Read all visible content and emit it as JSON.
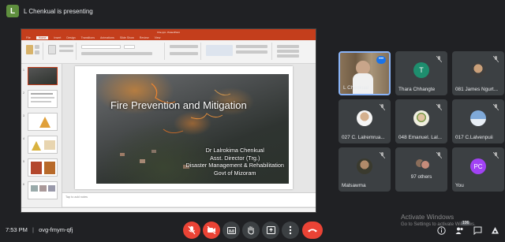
{
  "presenting": {
    "badge": "L",
    "text": "L Chenkual is presenting"
  },
  "ppt": {
    "title_text": "Fire ppt - PowerPoint",
    "tabs": [
      "File",
      "Home",
      "Insert",
      "Design",
      "Transitions",
      "Animations",
      "Slide Show",
      "Review",
      "View"
    ],
    "slide_title": "Fire Prevention and Mitigation",
    "slide_sub": [
      "Dr Lalrokima Chenkual",
      "Asst. Director (Trg.)",
      "Disaster Management & Rehabilitation",
      "Govt of Mizoram"
    ],
    "notes_placeholder": "Tap to add notes"
  },
  "participants": [
    {
      "name": "L Chenkual",
      "kind": "video-speaker"
    },
    {
      "name": "Thara Chhangte",
      "kind": "initial",
      "initial": "T",
      "color": "#1e8e6e"
    },
    {
      "name": "081 James Ngurt...",
      "kind": "photo"
    },
    {
      "name": "027 C. Lalremrua...",
      "kind": "photo"
    },
    {
      "name": "048 Emanuel. Lal...",
      "kind": "photo"
    },
    {
      "name": "017 C.Lalvenpuii",
      "kind": "photo"
    },
    {
      "name": "Malsawma",
      "kind": "photo"
    },
    {
      "name": "97 others",
      "kind": "others"
    },
    {
      "name": "You",
      "kind": "initial",
      "initial": "PC",
      "color": "#a142f4"
    }
  ],
  "bottom": {
    "time": "7:53 PM",
    "separator": "|",
    "meeting_code": "ovg-fmym-qfj"
  },
  "watermark": {
    "line1": "Activate Windows",
    "line2": "Go to Settings to activate Windows."
  },
  "colors": {
    "accent": "#8ab4f8",
    "danger": "#ea4335",
    "bg": "#202124",
    "tile": "#3c4043"
  },
  "icons": [
    "mic-off-icon",
    "camera-off-icon",
    "captions-icon",
    "raise-hand-icon",
    "present-icon",
    "more-icon",
    "hang-up-icon",
    "info-icon",
    "people-icon",
    "chat-icon",
    "activities-icon"
  ]
}
